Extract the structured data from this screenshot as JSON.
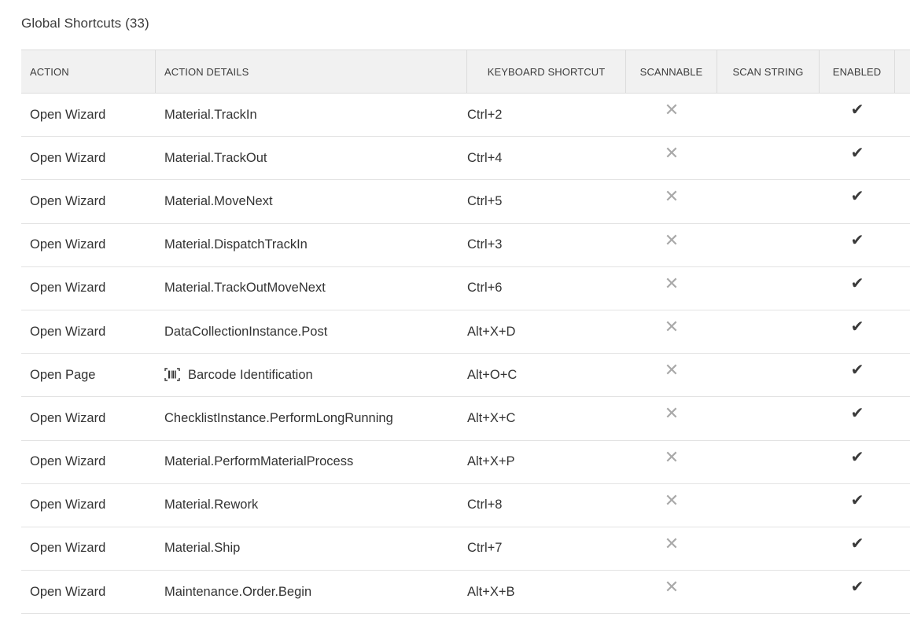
{
  "panel": {
    "title": "Global Shortcuts (33)"
  },
  "table": {
    "headers": {
      "action": "ACTION",
      "details": "ACTION DETAILS",
      "shortcut": "KEYBOARD SHORTCUT",
      "scannable": "SCANNABLE",
      "scan_string": "SCAN STRING",
      "enabled": "ENABLED"
    },
    "rows": [
      {
        "action": "Open Wizard",
        "details": "Material.TrackIn",
        "shortcut": "Ctrl+2",
        "scannable": false,
        "scan_string": "",
        "enabled": true
      },
      {
        "action": "Open Wizard",
        "details": "Material.TrackOut",
        "shortcut": "Ctrl+4",
        "scannable": false,
        "scan_string": "",
        "enabled": true
      },
      {
        "action": "Open Wizard",
        "details": "Material.MoveNext",
        "shortcut": "Ctrl+5",
        "scannable": false,
        "scan_string": "",
        "enabled": true
      },
      {
        "action": "Open Wizard",
        "details": "Material.DispatchTrackIn",
        "shortcut": "Ctrl+3",
        "scannable": false,
        "scan_string": "",
        "enabled": true
      },
      {
        "action": "Open Wizard",
        "details": "Material.TrackOutMoveNext",
        "shortcut": "Ctrl+6",
        "scannable": false,
        "scan_string": "",
        "enabled": true
      },
      {
        "action": "Open Wizard",
        "details": "DataCollectionInstance.Post",
        "shortcut": "Alt+X+D",
        "scannable": false,
        "scan_string": "",
        "enabled": true
      },
      {
        "action": "Open Page",
        "details": "Barcode Identification",
        "details_icon": "barcode-icon",
        "shortcut": "Alt+O+C",
        "scannable": false,
        "scan_string": "",
        "enabled": true
      },
      {
        "action": "Open Wizard",
        "details": "ChecklistInstance.PerformLongRunning",
        "shortcut": "Alt+X+C",
        "scannable": false,
        "scan_string": "",
        "enabled": true
      },
      {
        "action": "Open Wizard",
        "details": "Material.PerformMaterialProcess",
        "shortcut": "Alt+X+P",
        "scannable": false,
        "scan_string": "",
        "enabled": true
      },
      {
        "action": "Open Wizard",
        "details": "Material.Rework",
        "shortcut": "Ctrl+8",
        "scannable": false,
        "scan_string": "",
        "enabled": true
      },
      {
        "action": "Open Wizard",
        "details": "Material.Ship",
        "shortcut": "Ctrl+7",
        "scannable": false,
        "scan_string": "",
        "enabled": true
      },
      {
        "action": "Open Wizard",
        "details": "Maintenance.Order.Begin",
        "shortcut": "Alt+X+B",
        "scannable": false,
        "scan_string": "",
        "enabled": true
      }
    ]
  },
  "icons": {
    "not_scannable": "x-icon",
    "enabled": "check-icon"
  },
  "colors": {
    "header_bg": "#f1f1f1",
    "border": "#dcdcdc",
    "x_icon": "#a9a9a9",
    "check_icon": "#3a3a3a"
  }
}
